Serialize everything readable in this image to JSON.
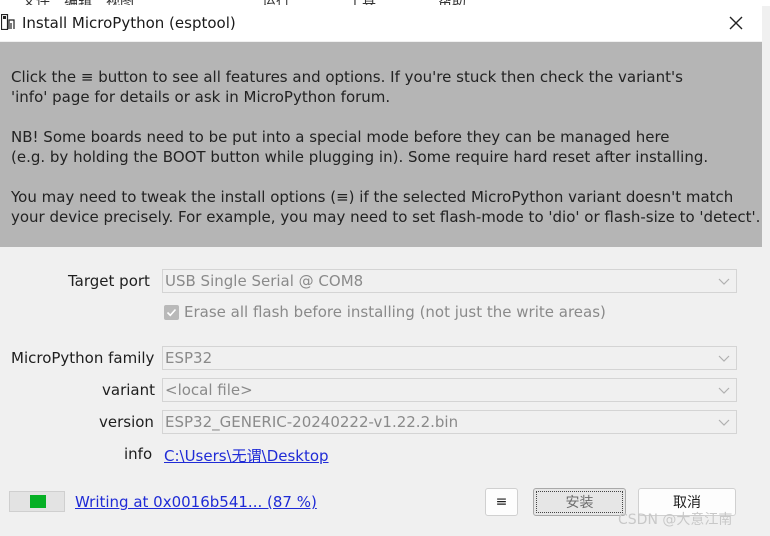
{
  "menubar": {
    "items": [
      "文件",
      "编辑",
      "视图",
      "运行",
      "工具",
      "帮助"
    ]
  },
  "dialog": {
    "title": "Install MicroPython (esptool)",
    "close_glyph": "✕"
  },
  "info_panel": {
    "p1_line1": "Click the ≡ button to see all features and options. If you're stuck then check the variant's",
    "p1_line2": "'info' page for details or ask in MicroPython forum.",
    "p2_line1": "NB! Some boards need to be put into a special mode before they can be managed here",
    "p2_line2": "(e.g. by holding the BOOT button while plugging in). Some require hard reset after installing.",
    "p3_line1": "You may need to tweak the install options (≡) if the selected MicroPython variant doesn't match",
    "p3_line2": "your device precisely. For example, you may need to set flash-mode to 'dio' or flash-size to 'detect'."
  },
  "form": {
    "target_port": {
      "label": "Target port",
      "value": "USB Single Serial @ COM8"
    },
    "erase_flash": {
      "label": "Erase all flash before installing (not just the write areas)",
      "checked": true
    },
    "family": {
      "label": "MicroPython family",
      "value": "ESP32"
    },
    "variant": {
      "label": "variant",
      "value": "<local file>"
    },
    "version": {
      "label": "version",
      "value": "ESP32_GENERIC-20240222-v1.22.2.bin"
    },
    "info": {
      "label": "info",
      "link": "C:\\Users\\无谓\\Desktop"
    }
  },
  "footer": {
    "progress_fraction": 0.87,
    "progress_color": "#06b025",
    "status": "Writing at 0x0016b541... (87 %)",
    "menu_button": "≡",
    "install_button": "安装",
    "cancel_button": "取消"
  },
  "watermark": "CSDN @大意江南",
  "colors": {
    "info_panel_bg": "#b5b5b5",
    "link": "#1f2bd6",
    "disabled_text": "#8a8a8a"
  }
}
